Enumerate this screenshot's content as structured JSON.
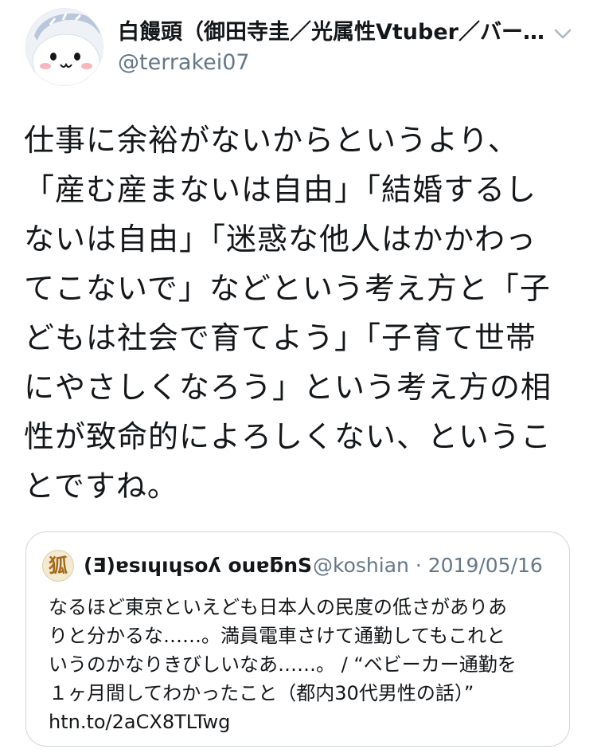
{
  "tweet": {
    "author": {
      "display_name": "白饅頭（御田寺圭／光属性Vtuber／バーチ…",
      "handle": "@terrakei07",
      "avatar_icon": "manju-face-avatar-icon"
    },
    "menu_icon": "chevron-down-icon",
    "text": "仕事に余裕がないからというより、「産む産まないは自由」「結婚するしないは自由」「迷惑な他人はかかわってこないで」などという考え方と「子どもは社会で育てよう」「子育て世帯にやさしくなろう」という考え方の相性が致命的によろしくない、ということですね。",
    "text_lines": [
      "仕事に余裕がないからというより、",
      "「産む産まないは自由」「結婚するし",
      "ないは自由」「迷惑な他人はかかわっ",
      "てこないで」などという考え方と「子",
      "どもは社会で育てよう」「子育て世帯",
      "にやさしくなろう」という考え方の相",
      "性が致命的によろしくない、というこ",
      "とですね。"
    ]
  },
  "quoted_tweet": {
    "avatar_glyph": "狐",
    "display_name_flipped": "Sugano yoshihisa(∃)",
    "display_name_shown": "(Ǝ)ɐsıɥıɥsoʎ ouɐƃnS",
    "handle": "@koshian",
    "separator": "·",
    "date": "2019/05/16",
    "text_lines": [
      "なるほど東京といえども日本人の民度の低さがありあ",
      "りと分かるな……。満員電車さけて通勤してもこれと",
      "いうのかなりきびしいなあ……。 / “ベビーカー通勤を",
      "１ヶ月間してわかったこと（都内30代男性の話）”",
      "htn.to/2aCX8TLTwg"
    ]
  },
  "colors": {
    "text_primary": "#14171a",
    "text_secondary": "#657786",
    "border": "#ccd6dd",
    "chevron": "#aab8c2"
  }
}
